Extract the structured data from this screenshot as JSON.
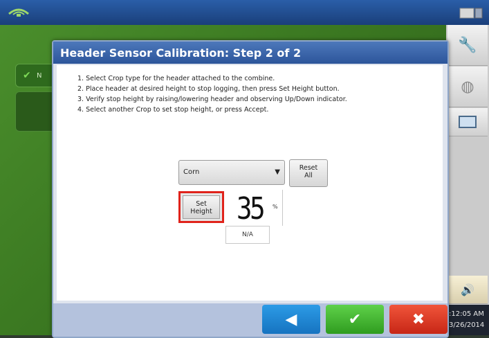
{
  "background": {
    "tab_label": "N"
  },
  "dialog": {
    "title": "Header Sensor Calibration:  Step 2 of 2",
    "instructions": [
      "1. Select Crop type for the header attached to the combine.",
      "2. Place header at desired height to stop logging, then press Set Height button.",
      "3. Verify stop height by raising/lowering header and observing Up/Down indicator.",
      "4. Select another Crop to set stop height, or press Accept."
    ],
    "crop_select": {
      "value": "Corn"
    },
    "reset_button": {
      "line1": "Reset",
      "line2": "All"
    },
    "set_height_button": {
      "line1": "Set",
      "line2": "Height"
    },
    "height_value": "35",
    "height_unit": "%",
    "status_value": "N/A"
  },
  "clock": {
    "time": ":12:05 AM",
    "date": "3/26/2014"
  },
  "colors": {
    "accent": "#2c559a",
    "back": "#1673c0",
    "accept": "#2f9c1f",
    "cancel": "#c72616",
    "highlight": "#e0231b"
  },
  "icons": [
    "satellite-icon",
    "screen-icon",
    "wrench-icon",
    "grain-icon",
    "window-icon",
    "speaker-icon"
  ]
}
